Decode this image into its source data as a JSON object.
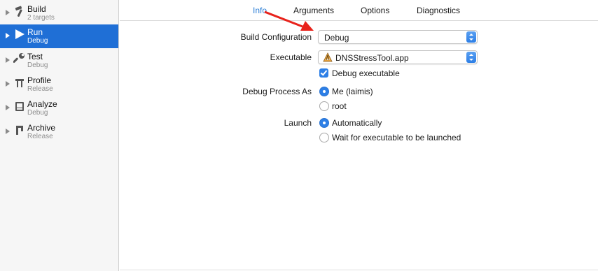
{
  "sidebar": {
    "items": [
      {
        "title": "Build",
        "subtitle": "2 targets",
        "icon": "hammer-icon"
      },
      {
        "title": "Run",
        "subtitle": "Debug",
        "icon": "play-icon",
        "selected": true
      },
      {
        "title": "Test",
        "subtitle": "Debug",
        "icon": "wrench-icon"
      },
      {
        "title": "Profile",
        "subtitle": "Release",
        "icon": "instruments-icon"
      },
      {
        "title": "Analyze",
        "subtitle": "Debug",
        "icon": "analyze-icon"
      },
      {
        "title": "Archive",
        "subtitle": "Release",
        "icon": "archive-icon"
      }
    ]
  },
  "tabs": [
    {
      "label": "Info",
      "active": true
    },
    {
      "label": "Arguments"
    },
    {
      "label": "Options"
    },
    {
      "label": "Diagnostics"
    }
  ],
  "form": {
    "build_configuration": {
      "label": "Build Configuration",
      "value": "Debug"
    },
    "executable": {
      "label": "Executable",
      "value": "DNSStressTool.app"
    },
    "debug_executable": {
      "label": "Debug executable",
      "checked": true
    },
    "debug_process_as": {
      "label": "Debug Process As",
      "options": [
        "Me (laimis)",
        "root"
      ],
      "selected": "Me (laimis)"
    },
    "launch": {
      "label": "Launch",
      "options": [
        "Automatically",
        "Wait for executable to be launched"
      ],
      "selected": "Automatically"
    }
  },
  "colors": {
    "selection": "#1f6fd6",
    "accent": "#2d7fe6",
    "active_tab": "#2d7fd6",
    "annotation_arrow": "#e8221b"
  }
}
